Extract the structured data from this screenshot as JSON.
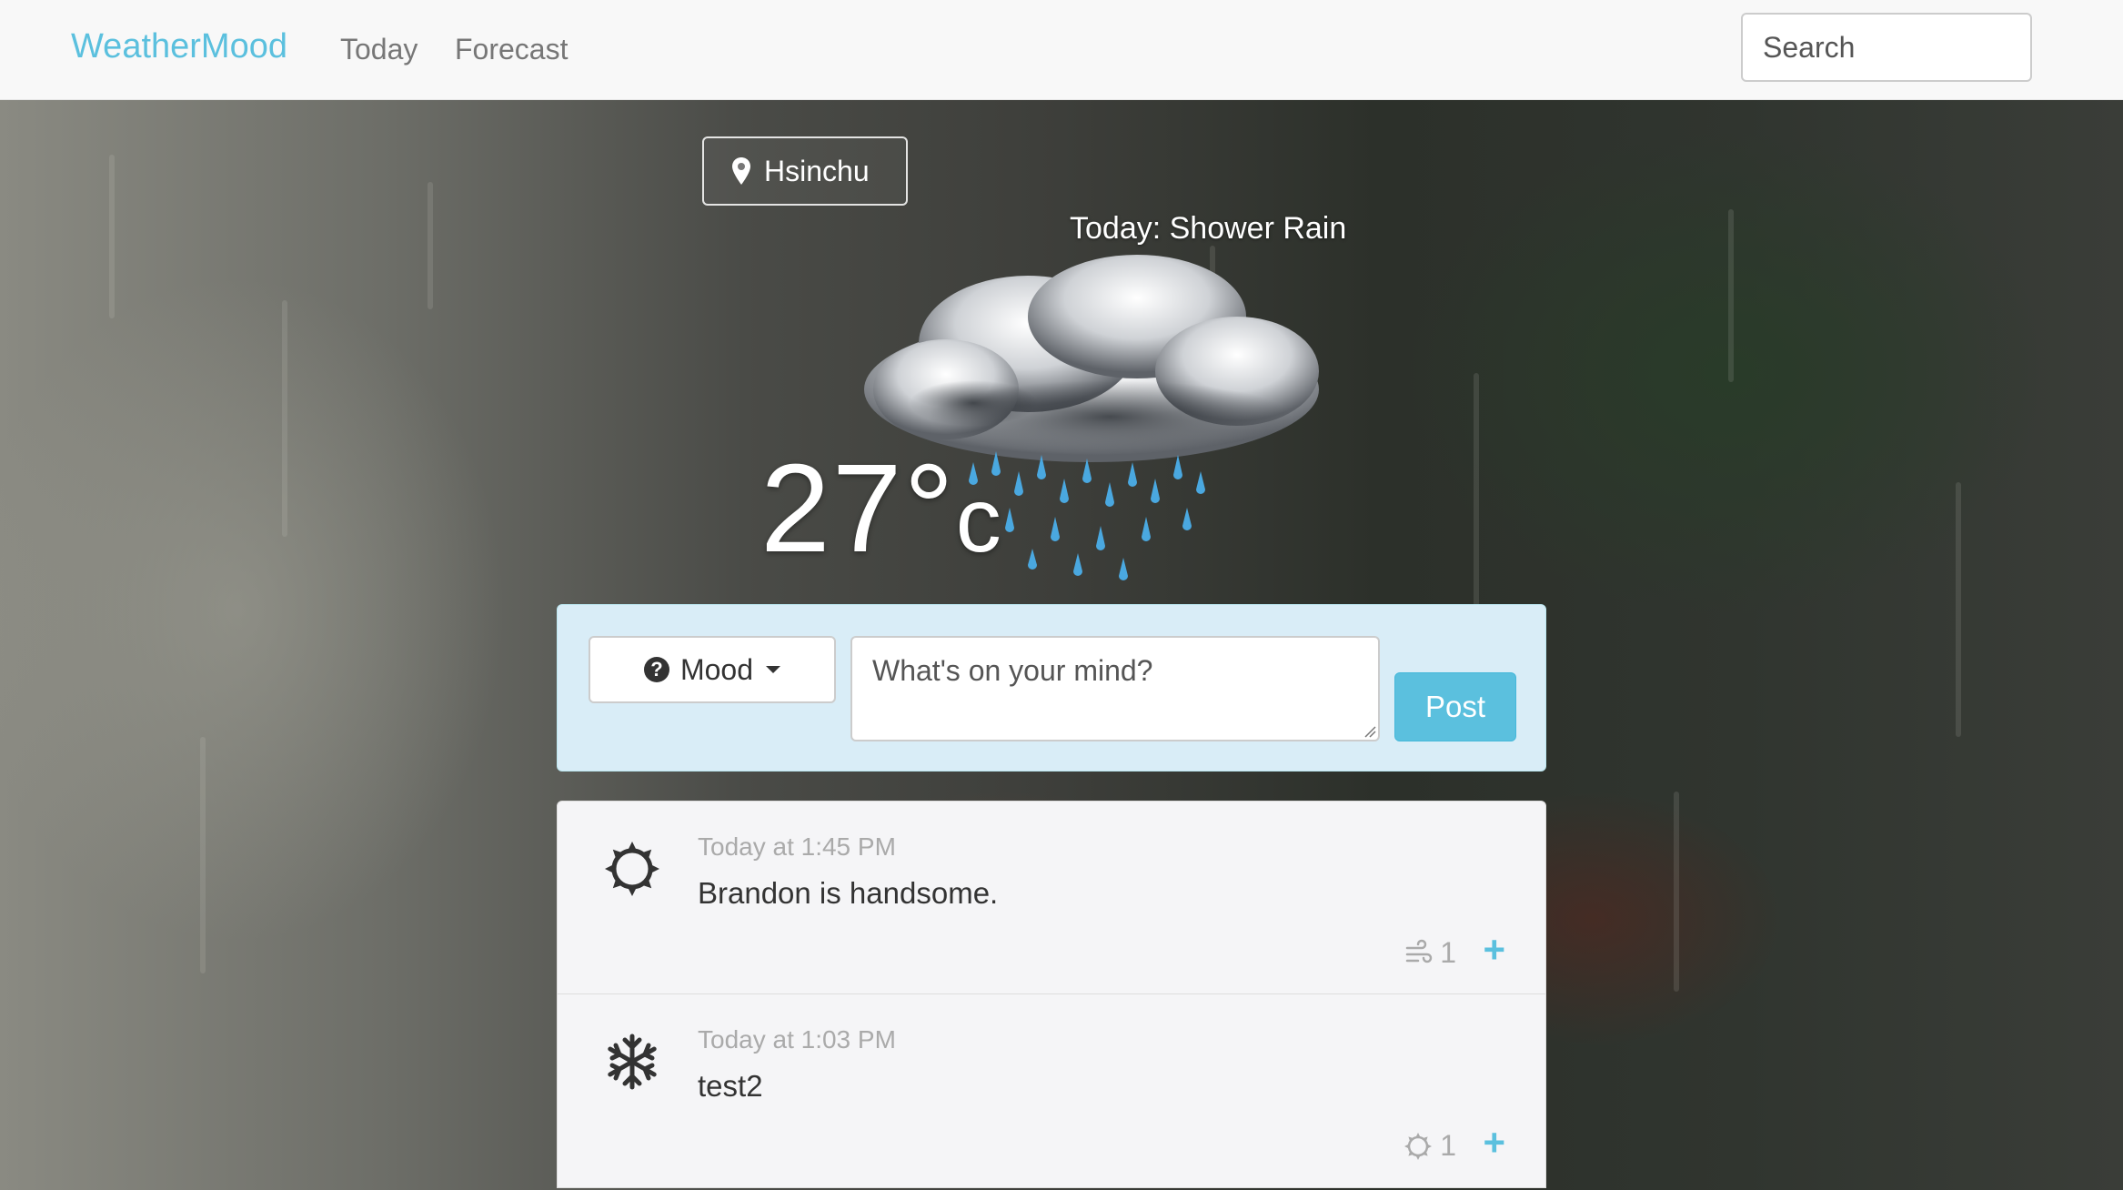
{
  "navbar": {
    "brand": "WeatherMood",
    "links": [
      "Today",
      "Forecast"
    ],
    "search_placeholder": "Search"
  },
  "location": {
    "label": "Hsinchu",
    "icon": "map-pin-icon"
  },
  "weather": {
    "today_label": "Today: Shower Rain",
    "icon": "shower-rain-cloud-icon",
    "temperature": "27°",
    "unit": "c"
  },
  "post_box": {
    "mood_label": "Mood",
    "mood_icon": "question-circle-icon",
    "placeholder": "What's on your mind?",
    "post_label": "Post"
  },
  "feed": [
    {
      "mood_icon": "sun-icon",
      "time": "Today at 1:45 PM",
      "text": "Brandon is handsome.",
      "reaction_icon": "wind-icon",
      "reaction_count": "1"
    },
    {
      "mood_icon": "snowflake-icon",
      "time": "Today at 1:03 PM",
      "text": "test2",
      "reaction_icon": "sun-icon",
      "reaction_count": "1"
    }
  ],
  "colors": {
    "accent": "#5bc0de",
    "navbar_bg": "#f8f8f8",
    "post_box_bg": "#d9edf7"
  }
}
